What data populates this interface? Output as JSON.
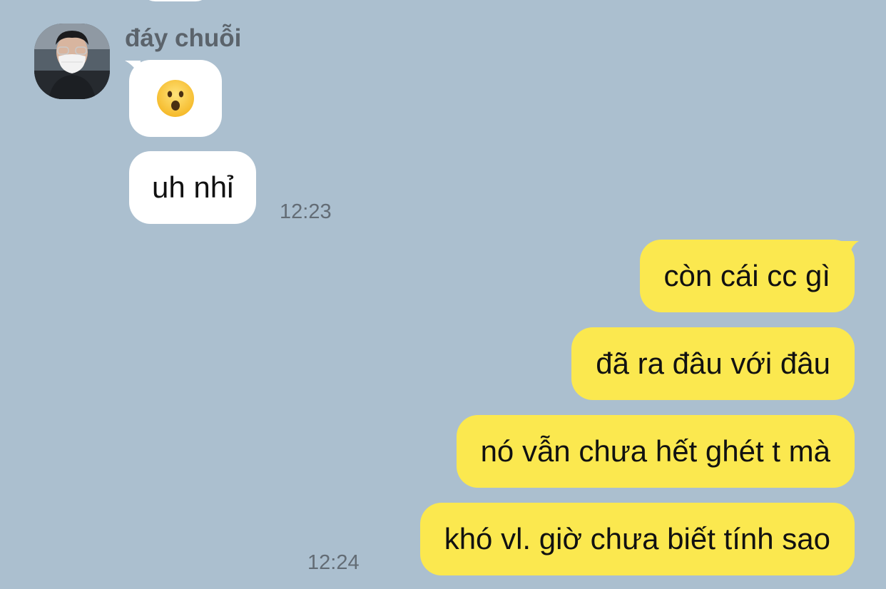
{
  "contact": {
    "name": "đáy chuỗi"
  },
  "incoming": [
    {
      "type": "emoji",
      "emoji": "frowning-open-mouth-face"
    },
    {
      "type": "text",
      "text": "uh nhỉ",
      "time": "12:23"
    }
  ],
  "outgoing": [
    {
      "text": "còn cái cc gì"
    },
    {
      "text": "đã ra đâu với đâu"
    },
    {
      "text": "nó vẫn chưa hết ghét t mà"
    },
    {
      "text": "khó vl. giờ chưa biết tính sao",
      "time": "12:24"
    }
  ],
  "colors": {
    "background": "#abbfcf",
    "incoming_bubble": "#ffffff",
    "outgoing_bubble": "#fbe84f",
    "name_text": "#5b636b",
    "time_text": "#636c75"
  }
}
